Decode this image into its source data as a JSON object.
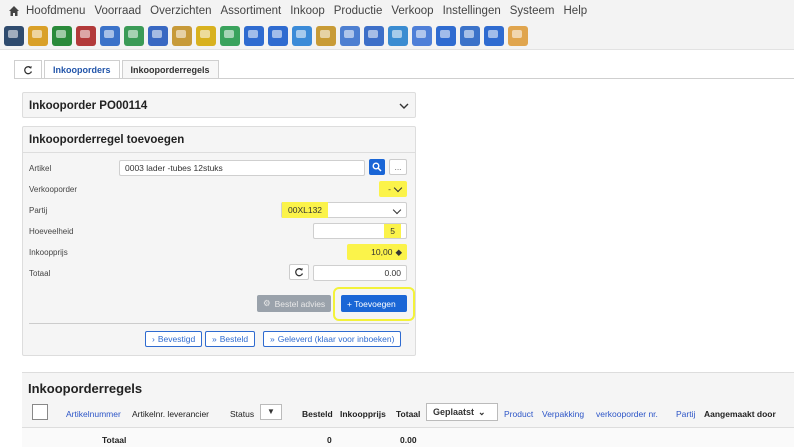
{
  "menu": {
    "items": [
      "Hoofdmenu",
      "Voorraad",
      "Overzichten",
      "Assortiment",
      "Inkoop",
      "Productie",
      "Verkoop",
      "Instellingen",
      "Systeem",
      "Help"
    ]
  },
  "toolbar": {
    "icon_colors": [
      "#2f4b6e",
      "#d9a028",
      "#2a8a3a",
      "#b23a3a",
      "#3b72c9",
      "#3b9b57",
      "#3968c2",
      "#c79a39",
      "#d8b11f",
      "#3aa35d",
      "#2f6bd0",
      "#2f6bd0",
      "#3b8bd8",
      "#c89b36",
      "#4d7fd1",
      "#3d6fc8",
      "#3a8cd1",
      "#4e7fd8",
      "#2f6bd0",
      "#3b72c9",
      "#2f6bd0",
      "#e0a54e"
    ]
  },
  "tabs": {
    "refresh_icon": "refresh-icon",
    "items": [
      {
        "label": "Inkooporders"
      },
      {
        "label": "Inkooporderregels"
      }
    ]
  },
  "order_panel": {
    "title": "Inkooporder PO00114"
  },
  "form": {
    "title": "Inkooporderregel toevoegen",
    "artikel_label": "Artikel",
    "artikel_value": "0003 lader -tubes 12stuks",
    "verkooporder_label": "Verkooporder",
    "verkooporder_value": "-",
    "partij_label": "Partij",
    "partij_value": "00XL132",
    "hoeveelheid_label": "Hoeveelheid",
    "hoeveelheid_value": "5",
    "inkoopprijs_label": "Inkoopprijs",
    "inkoopprijs_value": "10,00",
    "totaal_label": "Totaal",
    "totaal_value": "0.00",
    "bestel_advies": "Bestel advies",
    "toevoegen": "+ Toevoegen",
    "bevestigd": "Bevestigd",
    "besteld": "Besteld",
    "geleverd": "Geleverd (klaar voor inboeken)"
  },
  "grid": {
    "title": "Inkooporderregels",
    "columns": {
      "artikelnummer": "Artikelnummer",
      "artikelnr_lev": "Artikelnr. leverancier",
      "status": "Status",
      "besteld": "Besteld",
      "inkoopprijs": "Inkoopprijs",
      "totaal": "Totaal",
      "geplaatst": "Geplaatst",
      "product": "Product",
      "verpakking": "Verpakking",
      "verkooporder_nr": "verkooporder nr.",
      "partij": "Partij",
      "aangemaakt_door": "Aangemaakt door"
    },
    "footer": {
      "label": "Totaal",
      "besteld": "0",
      "totaal": "0.00"
    }
  },
  "colors": {
    "accent": "#1a66d6",
    "highlight": "#fbf34a",
    "link": "#2c55c7"
  }
}
